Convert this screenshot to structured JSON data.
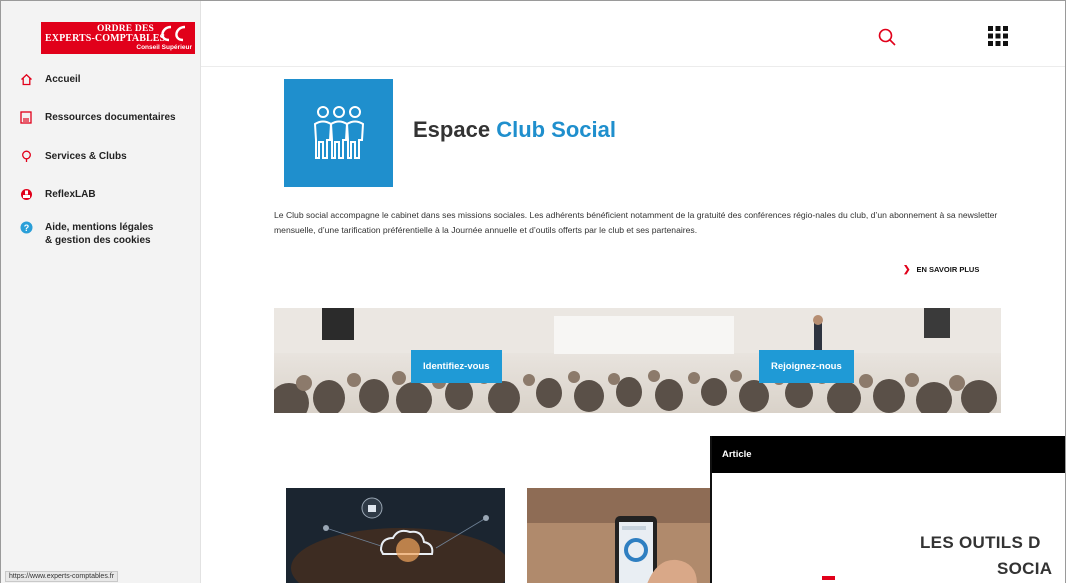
{
  "logo": {
    "line1": "ORDRE DES",
    "line2": "EXPERTS-COMPTABLES",
    "line3": "Conseil Supérieur"
  },
  "sidebar": {
    "items": [
      {
        "label": "Accueil",
        "icon": "home-icon"
      },
      {
        "label": "Ressources documentaires",
        "icon": "document-icon"
      },
      {
        "label": "Services & Clubs",
        "icon": "lightbulb-icon"
      },
      {
        "label": "ReflexLAB",
        "icon": "flask-icon"
      },
      {
        "label": "Aide, mentions légales",
        "label2": "& gestion des cookies",
        "icon": "help-icon"
      }
    ]
  },
  "status_url": "https://www.experts-comptables.fr",
  "topbar": {
    "search_icon": "search-icon",
    "apps_icon": "apps-grid-icon"
  },
  "main": {
    "title_prefix": "Espace",
    "title_accent": "Club Social",
    "intro": "Le Club social accompagne le cabinet dans ses missions sociales. Les adhérents bénéficient notamment de la gratuité des conférences régio-nales du club, d’un abonnement à sa newsletter mensuelle, d’une tarification préférentielle à la Journée annuelle et d’outils offerts par le club et ses partenaires.",
    "more_label": "EN SAVOIR PLUS",
    "banner_buttons": [
      "Identifiez-vous",
      "Rejoignez-nous"
    ]
  },
  "article": {
    "header": "Article",
    "title_line1": "LES OUTILS D",
    "title_line2": "SOCIA"
  },
  "colors": {
    "brand_red": "#e1001a",
    "accent_blue": "#1f8fcd",
    "button_blue": "#1f9ad6"
  }
}
